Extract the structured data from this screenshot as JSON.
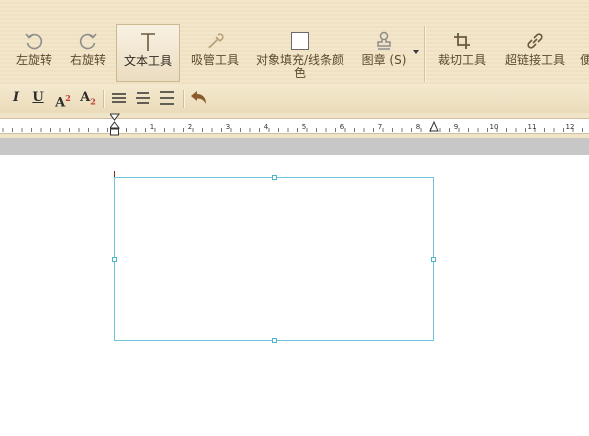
{
  "toolbar": {
    "rotate_left": "左旋转",
    "rotate_right": "右旋转",
    "text_tool": "文本工具",
    "eyedropper": "吸管工具",
    "fill_stroke": "对象填充/线条颜\n色",
    "stamp": "图章 (S)",
    "crop": "裁切工具",
    "hyperlink": "超链接工具",
    "cut_off": "便"
  },
  "format": {
    "italic": "I",
    "underline": "U",
    "superscript": "A",
    "superscript_mark": "2",
    "subscript": "A",
    "subscript_mark": "2"
  },
  "ruler": {
    "ticks": [
      "1",
      "2",
      "3",
      "4",
      "5",
      "6",
      "7",
      "8",
      "9",
      "10",
      "11",
      "12"
    ]
  },
  "colors": {
    "ribbon": "#f1e4c6",
    "selection": "#6fc3d8",
    "caret": "#8a2a1f"
  }
}
